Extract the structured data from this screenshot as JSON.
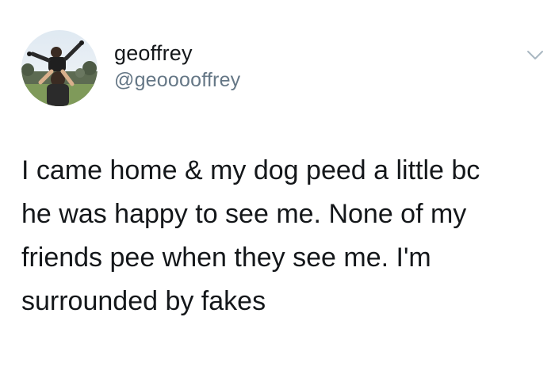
{
  "user": {
    "display_name": "geoffrey",
    "handle": "@geooooffrey",
    "avatar_icon": "profile-photo-avatar"
  },
  "menu": {
    "icon": "chevron-down-icon"
  },
  "tweet": {
    "lines": [
      "I came home & my dog peed a little bc",
      "he was happy to see me. None of my",
      "friends pee when they see me. I'm",
      "surrounded by fakes"
    ]
  },
  "colors": {
    "text_primary": "#14171a",
    "text_secondary": "#657786",
    "background": "#ffffff"
  }
}
